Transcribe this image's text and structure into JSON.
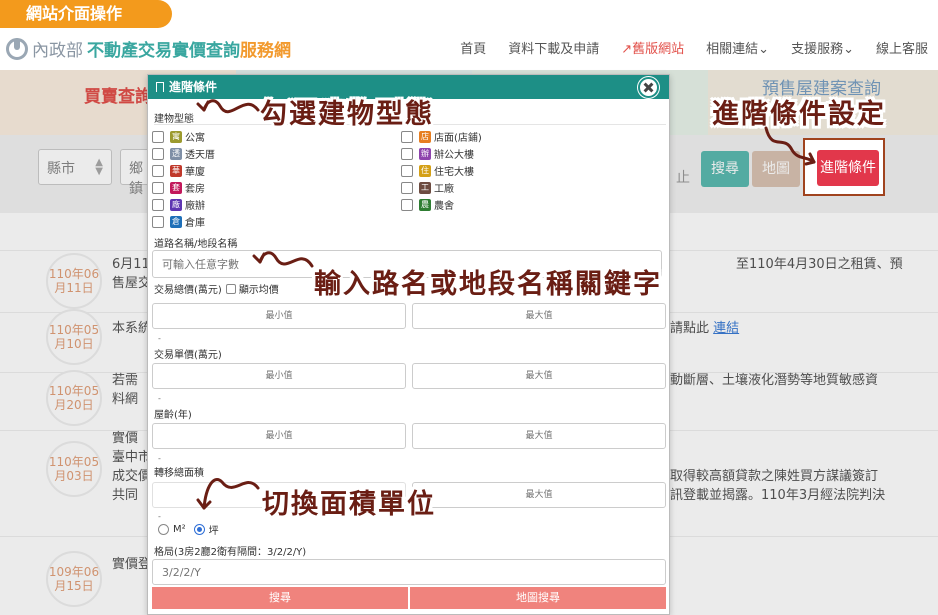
{
  "badge": "網站介面操作",
  "header": {
    "ministry": "內政部",
    "title": "不動產交易實價查詢",
    "subtitle": "服務網",
    "nav": [
      "首頁",
      "資料下載及申請",
      "舊版網站",
      "相關連結",
      "支援服務",
      "線上客服"
    ]
  },
  "background": {
    "hero_left": "買賣查詢",
    "hero_right": "預售屋建案查詢",
    "county_select": "縣市",
    "town_select": "鄉鎮",
    "search_label": "搜尋",
    "map_label": "地圖",
    "stop_text": "止",
    "news": [
      {
        "year": "110年06",
        "day": "月11日",
        "lines": [
          "6月11",
          "售屋交"
        ],
        "right": [
          "至110年4月30日之租賃、預"
        ]
      },
      {
        "year": "110年05",
        "day": "月10日",
        "lines": [
          "本系統"
        ],
        "right": [
          "請點此 "
        ],
        "link": "連結"
      },
      {
        "year": "110年05",
        "day": "月20日",
        "lines": [
          "若需",
          "料網"
        ],
        "right": [
          "動斷層、土壤液化潛勢等地質敏感資"
        ]
      },
      {
        "year": "110年05",
        "day": "月03日",
        "lines": [
          "實價",
          "臺中市",
          "成交價",
          "共同"
        ],
        "right": [
          "取得較高額貸款之陳姓買方謀議簽訂",
          "訊登載並揭露。110年3月經法院判決"
        ]
      },
      {
        "year": "109年06",
        "day": "月15日",
        "lines": [
          "實價登"
        ],
        "right": []
      }
    ]
  },
  "advanced_button": "進階條件",
  "annotations": {
    "building_type": "勾選建物型態",
    "advanced_setting": "進階條件設定",
    "road_keyword": "輸入路名或地段名稱關鍵字",
    "area_unit": "切換面積單位"
  },
  "modal": {
    "title": "進階條件",
    "building_type_label": "建物型態",
    "types_left": [
      {
        "tag": "寓",
        "label": "公寓",
        "color": "#9c9a2e"
      },
      {
        "tag": "透",
        "label": "透天厝",
        "color": "#7f8fa6"
      },
      {
        "tag": "華",
        "label": "華廈",
        "color": "#c0392b"
      },
      {
        "tag": "套",
        "label": "套房",
        "color": "#c2185b"
      },
      {
        "tag": "廠",
        "label": "廠辦",
        "color": "#5e35b1"
      },
      {
        "tag": "倉",
        "label": "倉庫",
        "color": "#1e6fb8"
      }
    ],
    "types_right": [
      {
        "tag": "店",
        "label": "店面(店鋪)",
        "color": "#e67e22"
      },
      {
        "tag": "辦",
        "label": "辦公大樓",
        "color": "#8e44ad"
      },
      {
        "tag": "住",
        "label": "住宅大樓",
        "color": "#d4a017"
      },
      {
        "tag": "工",
        "label": "工廠",
        "color": "#6d4c41"
      },
      {
        "tag": "農",
        "label": "農舍",
        "color": "#2e7d32"
      }
    ],
    "road_label": "道路名稱/地段名稱",
    "road_placeholder": "可輸入任意字數",
    "total_price_label": "交易總價(萬元)",
    "show_avg_label": "顯示均價",
    "unit_price_label": "交易單價(萬元)",
    "age_label": "屋齡(年)",
    "area_label": "轉移總面積",
    "min_placeholder": "最小值",
    "max_placeholder": "最大值",
    "dash": "-",
    "unit_m2": "M²",
    "unit_ping": "坪",
    "layout_label": "格局(3房2廳2衛有隔間：3/2/2/Y)",
    "layout_placeholder": "3/2/2/Y",
    "search_button": "搜尋",
    "map_search_button": "地圖搜尋"
  }
}
